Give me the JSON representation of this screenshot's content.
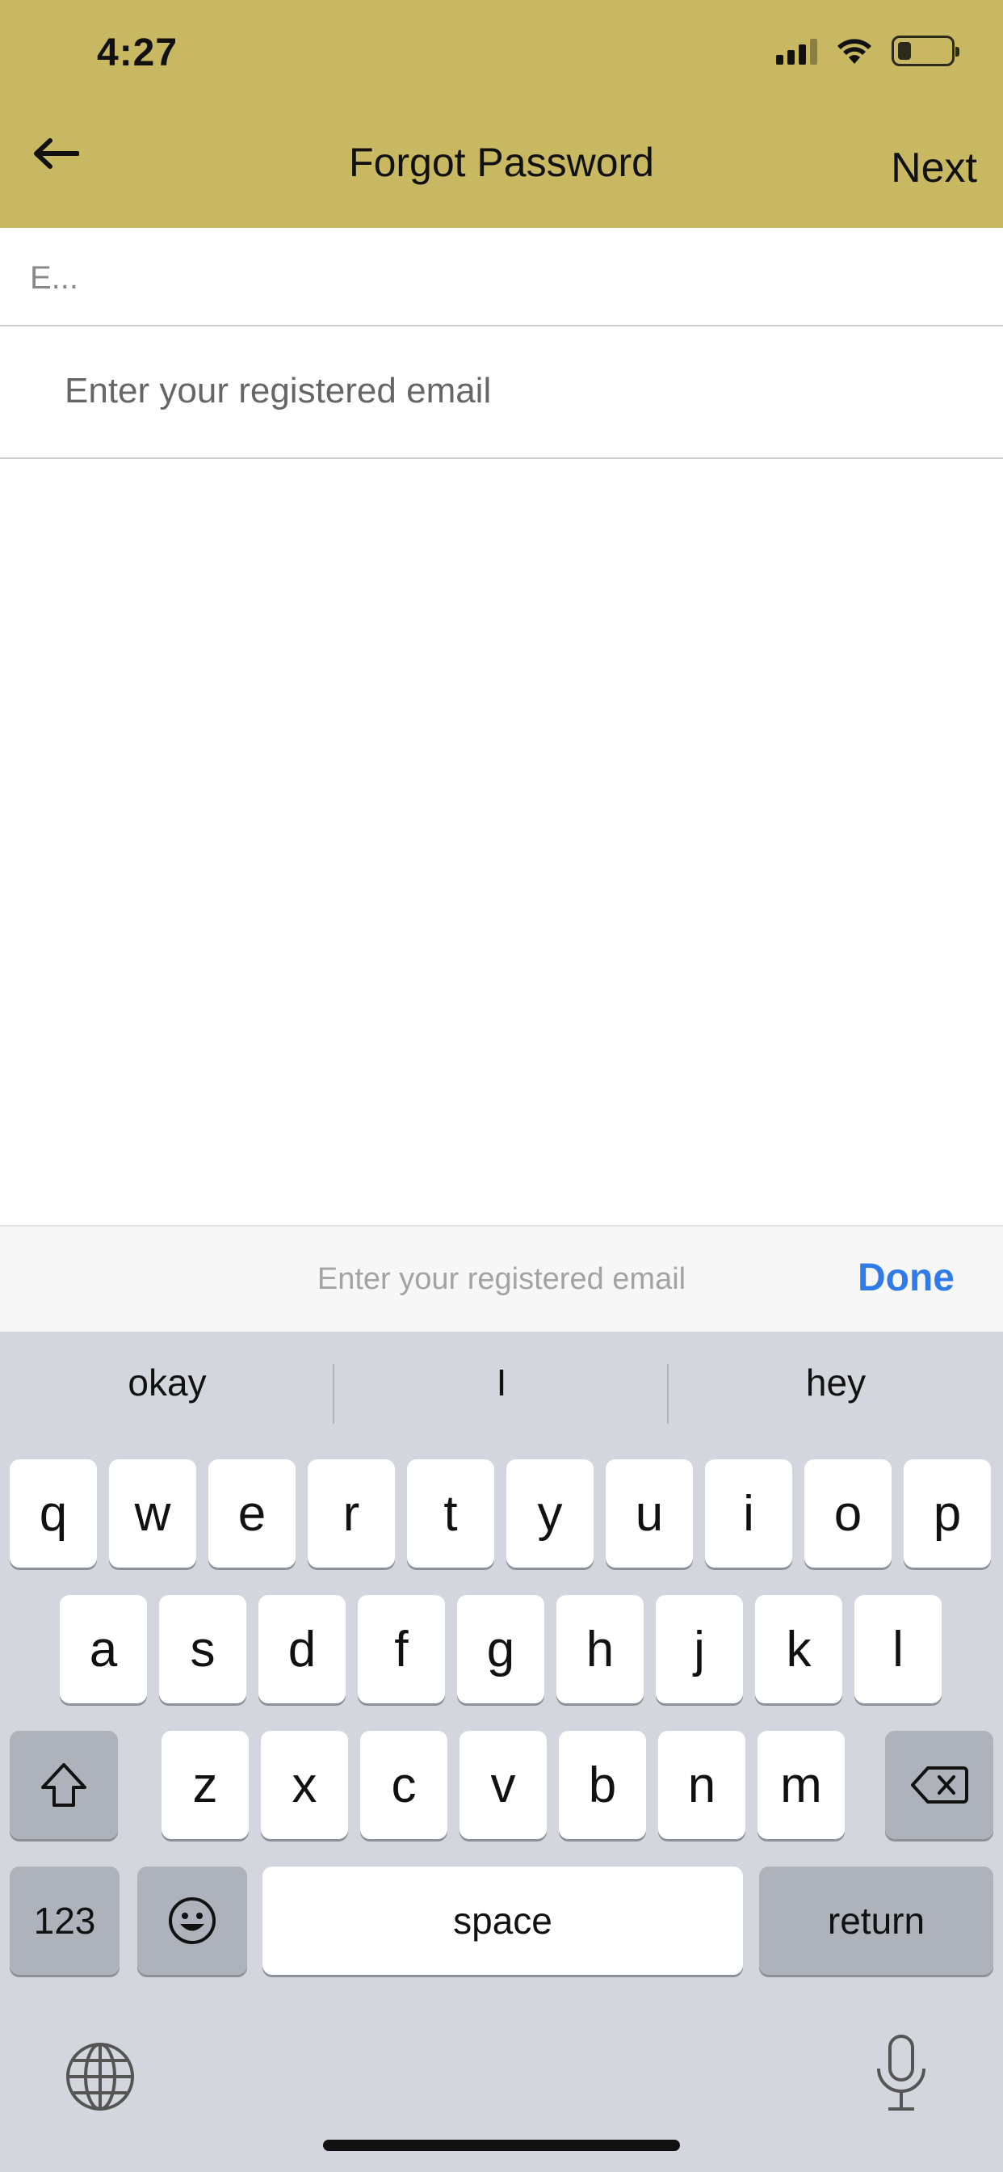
{
  "status_bar": {
    "time": "4:27"
  },
  "nav": {
    "title": "Forgot Password",
    "next_label": "Next"
  },
  "form": {
    "field_label": "E...",
    "email_placeholder": "Enter your registered email",
    "email_value": ""
  },
  "accessory": {
    "hint": "Enter your registered email",
    "done_label": "Done"
  },
  "keyboard": {
    "suggestions": [
      "okay",
      "I",
      "hey"
    ],
    "row1": [
      "q",
      "w",
      "e",
      "r",
      "t",
      "y",
      "u",
      "i",
      "o",
      "p"
    ],
    "row2": [
      "a",
      "s",
      "d",
      "f",
      "g",
      "h",
      "j",
      "k",
      "l"
    ],
    "row3": [
      "z",
      "x",
      "c",
      "v",
      "b",
      "n",
      "m"
    ],
    "numbers_label": "123",
    "space_label": "space",
    "return_label": "return"
  },
  "colors": {
    "header_bg": "#c9b862",
    "accent": "#2f7bea",
    "keyboard_bg": "#d3d6dc"
  }
}
